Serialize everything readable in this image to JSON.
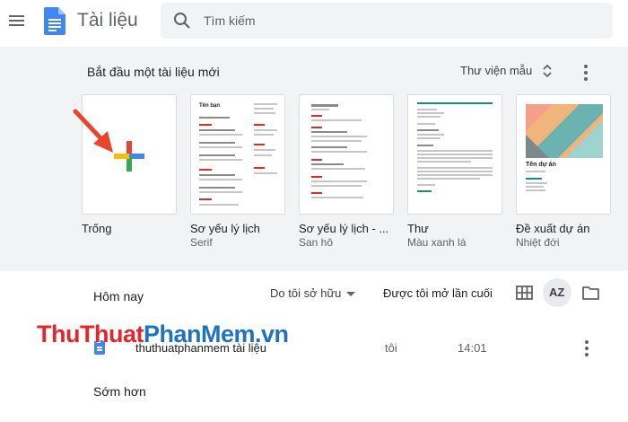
{
  "header": {
    "app_title": "Tài liệu",
    "search": {
      "placeholder": "Tìm kiếm",
      "value": ""
    }
  },
  "gallery": {
    "title": "Bắt đầu một tài liệu mới",
    "library_label": "Thư viện mẫu",
    "templates": [
      {
        "name": "Trống",
        "sub": "",
        "icon": "plus-icon"
      },
      {
        "name": "Sơ yếu lý lịch",
        "sub": "Serif",
        "thumb_title": "Tên bạn"
      },
      {
        "name": "Sơ yếu lý lịch - ...",
        "sub": "San hô"
      },
      {
        "name": "Thư",
        "sub": "Màu xanh lá"
      },
      {
        "name": "Đề xuất dự án",
        "sub": "Nhiệt đới",
        "thumb_title": "Tên dự án"
      }
    ]
  },
  "recent": {
    "today_label": "Hôm nay",
    "owner_filter": "Do tôi sở hữu",
    "last_opened_label": "Được tôi mở lần cuối",
    "sort_label": "AZ",
    "files": [
      {
        "name": "thuthuatphanmem tài liệu",
        "owner": "tôi",
        "date": "14:01"
      }
    ],
    "earlier_label": "Sớm hơn"
  },
  "watermark": {
    "part1": "ThuThuat",
    "part2": "PhanMem",
    "part3": ".vn"
  },
  "colors": {
    "docs_blue": "#4285f4",
    "red": "#ea4335",
    "yellow": "#fbbc04",
    "green": "#34a853",
    "gallery_bg": "#f1f3f4"
  }
}
